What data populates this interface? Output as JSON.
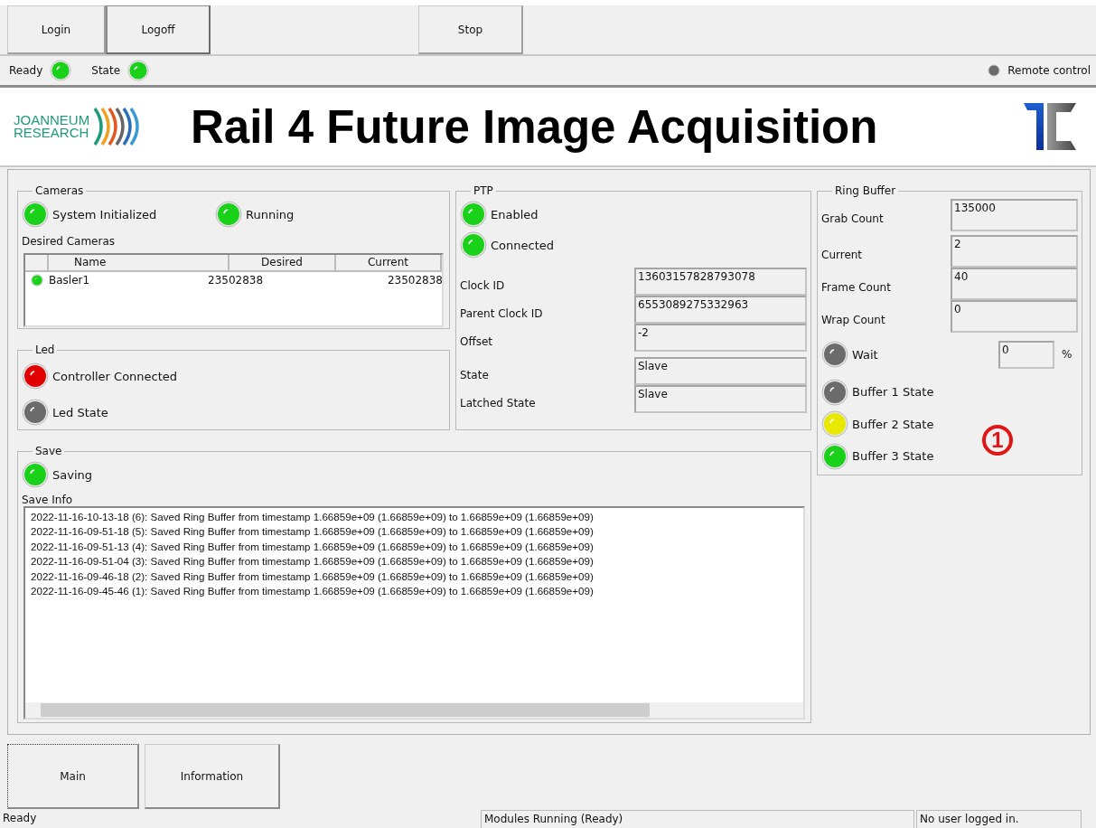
{
  "toolbar": {
    "left_buttons": [
      {
        "label": "Login",
        "pressed": false
      },
      {
        "label": "Logoff",
        "pressed": true
      }
    ],
    "center_buttons": [
      {
        "label": "Stop",
        "pressed": false
      }
    ]
  },
  "status_row": {
    "indicators": [
      {
        "label": "Ready",
        "color": "#19d119"
      },
      {
        "label": "State",
        "color": "#19d119"
      }
    ],
    "remote_control": {
      "label": "Remote control",
      "color": "#6b6b6b"
    }
  },
  "header": {
    "logo_lines": [
      "JOANNEUM",
      "RESEARCH"
    ],
    "title": "Rail 4 Future Image Acquisition"
  },
  "cameras": {
    "title": "Cameras",
    "leds": [
      {
        "label": "System Initialized",
        "color": "#19d119"
      },
      {
        "label": "Running",
        "color": "#19d119"
      }
    ],
    "desired_label": "Desired Cameras",
    "table": {
      "columns": [
        "Name",
        "Desired",
        "Current"
      ],
      "rows": [
        {
          "color": "#19d119",
          "cells": [
            "Basler1",
            "23502838",
            "23502838"
          ]
        }
      ]
    }
  },
  "led": {
    "title": "Led",
    "leds": [
      {
        "label": "Controller Connected",
        "color": "#e00000"
      },
      {
        "label": "Led State",
        "color": "#6b6b6b"
      }
    ]
  },
  "ptp": {
    "title": "PTP",
    "leds": [
      {
        "label": "Enabled",
        "color": "#19d119"
      },
      {
        "label": "Connected",
        "color": "#19d119"
      }
    ],
    "fields": [
      {
        "label": "Clock ID",
        "value": "13603157828793078"
      },
      {
        "label": "Parent Clock ID",
        "value": "6553089275332963"
      },
      {
        "label": "Offset",
        "value": "-2"
      },
      {
        "label": "State",
        "value": "Slave"
      },
      {
        "label": "Latched State",
        "value": "Slave"
      }
    ]
  },
  "ring_buffer": {
    "title": "Ring Buffer",
    "fields": [
      {
        "label": "Grab Count",
        "value": "135000"
      },
      {
        "label": "Current",
        "value": "2"
      },
      {
        "label": "Frame Count",
        "value": "40"
      },
      {
        "label": "Wrap Count",
        "value": "0"
      }
    ],
    "wait": {
      "label": "Wait",
      "color": "#6b6b6b",
      "value": "0",
      "unit": "%"
    },
    "buffers": [
      {
        "label": "Buffer 1 State",
        "color": "#6b6b6b"
      },
      {
        "label": "Buffer 2 State",
        "color": "#e8e800"
      },
      {
        "label": "Buffer 3 State",
        "color": "#19d119"
      }
    ],
    "annotation": "1"
  },
  "save": {
    "title": "Save",
    "led": {
      "label": "Saving",
      "color": "#19d119"
    },
    "info_label": "Save Info",
    "log": [
      "2022-11-16-10-13-18 (6): Saved Ring Buffer from timestamp 1.66859e+09 (1.66859e+09) to 1.66859e+09 (1.66859e+09)",
      "2022-11-16-09-51-18 (5): Saved Ring Buffer from timestamp 1.66859e+09 (1.66859e+09) to 1.66859e+09 (1.66859e+09)",
      "2022-11-16-09-51-13 (4): Saved Ring Buffer from timestamp 1.66859e+09 (1.66859e+09) to 1.66859e+09 (1.66859e+09)",
      "2022-11-16-09-51-04 (3): Saved Ring Buffer from timestamp 1.66859e+09 (1.66859e+09) to 1.66859e+09 (1.66859e+09)",
      "2022-11-16-09-46-18 (2): Saved Ring Buffer from timestamp 1.66859e+09 (1.66859e+09) to 1.66859e+09 (1.66859e+09)",
      "2022-11-16-09-45-46 (1): Saved Ring Buffer from timestamp 1.66859e+09 (1.66859e+09) to 1.66859e+09 (1.66859e+09)"
    ]
  },
  "tabs": [
    {
      "label": "Main",
      "selected": true
    },
    {
      "label": "Information",
      "selected": false
    }
  ],
  "status_bar": [
    "Ready",
    "Modules Running    (Ready)",
    "No user logged in."
  ]
}
